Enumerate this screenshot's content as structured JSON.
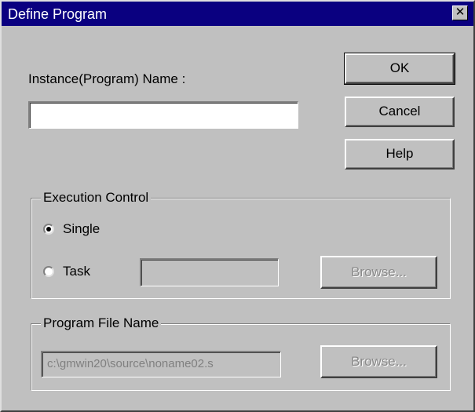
{
  "window": {
    "title": "Define Program",
    "close_glyph": "✕"
  },
  "instance": {
    "label": "Instance(Program) Name :",
    "value": ""
  },
  "buttons": {
    "ok": "OK",
    "cancel": "Cancel",
    "help": "Help"
  },
  "execution_control": {
    "legend": "Execution Control",
    "single_label": "Single",
    "single_selected": true,
    "task_label": "Task",
    "task_selected": false,
    "task_value": "",
    "browse_label": "Browse..."
  },
  "program_file": {
    "legend": "Program File Name",
    "value": "c:\\gmwin20\\source\\noname02.s",
    "browse_label": "Browse..."
  },
  "colors": {
    "title_bar": "#0a0080",
    "dialog_face": "#c0c0c0",
    "disabled_text": "#8a8a8a"
  }
}
